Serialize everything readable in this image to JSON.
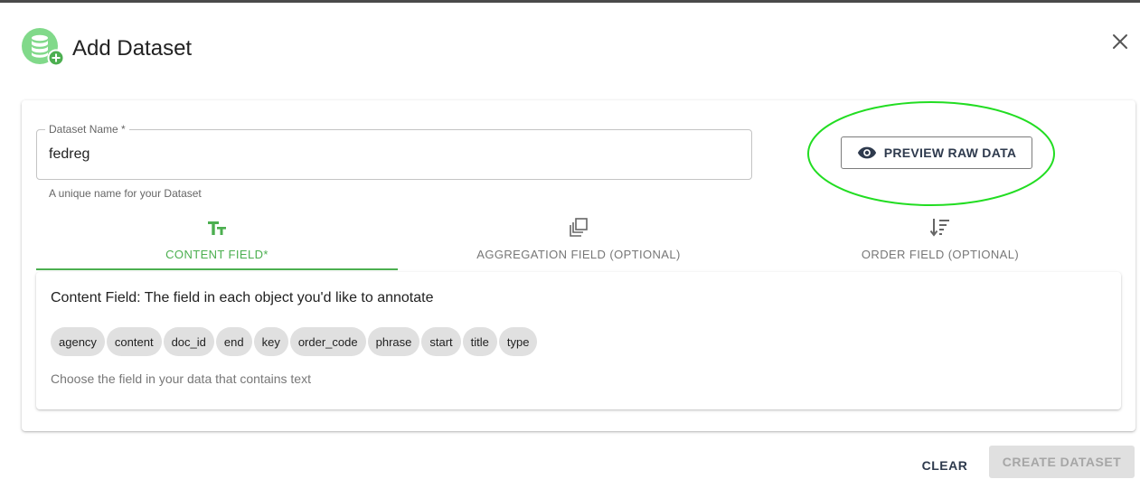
{
  "dialog": {
    "title": "Add Dataset",
    "header_icon": "database-add-icon",
    "close_icon": "close-icon"
  },
  "form": {
    "dataset_name": {
      "label": "Dataset Name *",
      "value": "fedreg",
      "helper": "A unique name for your Dataset"
    },
    "preview_button": {
      "label": "PREVIEW RAW DATA",
      "icon": "eye-icon"
    }
  },
  "tabs": [
    {
      "label": "CONTENT FIELD*",
      "icon": "text-format-icon",
      "active": true
    },
    {
      "label": "AGGREGATION FIELD (OPTIONAL)",
      "icon": "library-copy-icon",
      "active": false
    },
    {
      "label": "ORDER FIELD (OPTIONAL)",
      "icon": "sort-icon",
      "active": false
    }
  ],
  "content_panel": {
    "title": "Content Field: The field in each object you'd like to annotate",
    "chips": [
      "agency",
      "content",
      "doc_id",
      "end",
      "key",
      "order_code",
      "phrase",
      "start",
      "title",
      "type"
    ],
    "help": "Choose the field in your data that contains text"
  },
  "footer": {
    "clear_label": "CLEAR",
    "create_label": "CREATE DATASET"
  },
  "colors": {
    "accent_green": "#4caf50",
    "highlight_green": "#22dd22",
    "button_text": "#2e3a4d"
  }
}
